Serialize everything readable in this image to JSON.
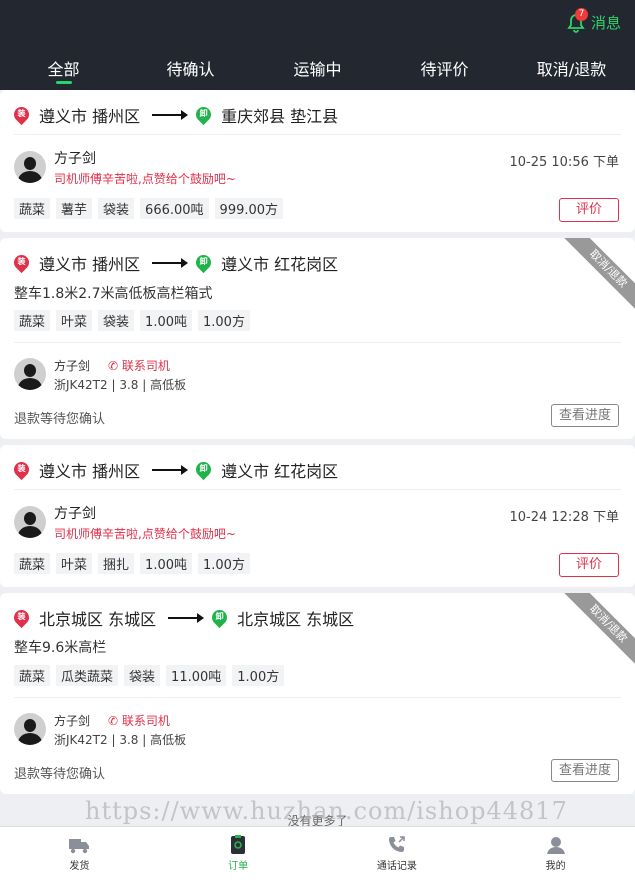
{
  "header": {
    "message_label": "消息",
    "message_count": "7",
    "tabs": [
      "全部",
      "待确认",
      "运输中",
      "待评价",
      "取消/退款"
    ],
    "active_tab": 0
  },
  "pins": {
    "load": "装",
    "unload": "卸"
  },
  "orders": [
    {
      "from": "遵义市 播州区",
      "to": "重庆郊县 垫江县",
      "name": "方子剑",
      "praise": "司机师傅辛苦啦,点赞给个鼓励吧~",
      "time": "10-25 10:56 下单",
      "tags": [
        "蔬菜",
        "薯芋",
        "袋装",
        "666.00吨",
        "999.00方"
      ],
      "action": "评价"
    },
    {
      "from": "遵义市 播州区",
      "to": "遵义市 红花岗区",
      "truck": "整车1.8米2.7米高低板高栏箱式",
      "tags": [
        "蔬菜",
        "叶菜",
        "袋装",
        "1.00吨",
        "1.00方"
      ],
      "driver": "方子剑",
      "call": "联系司机",
      "plate": "浙JK42T2 | 3.8 | 高低板",
      "status": "退款等待您确认",
      "action": "查看进度",
      "ribbon": "取消/退款"
    },
    {
      "from": "遵义市 播州区",
      "to": "遵义市 红花岗区",
      "name": "方子剑",
      "praise": "司机师傅辛苦啦,点赞给个鼓励吧~",
      "time": "10-24 12:28 下单",
      "tags": [
        "蔬菜",
        "叶菜",
        "捆扎",
        "1.00吨",
        "1.00方"
      ],
      "action": "评价"
    },
    {
      "from": "北京城区 东城区",
      "to": "北京城区 东城区",
      "truck": "整车9.6米高栏",
      "tags": [
        "蔬菜",
        "瓜类蔬菜",
        "袋装",
        "11.00吨",
        "1.00方"
      ],
      "driver": "方子剑",
      "call": "联系司机",
      "plate": "浙JK42T2 | 3.8 | 高低板",
      "status": "退款等待您确认",
      "action": "查看进度",
      "ribbon": "取消/退款"
    }
  ],
  "footer_text": "没有更多了",
  "watermark": "https://www.huzhan.com/ishop44817",
  "nav": [
    {
      "label": "发货",
      "icon": "truck-icon"
    },
    {
      "label": "订单",
      "icon": "order-icon"
    },
    {
      "label": "通话记录",
      "icon": "phone-icon"
    },
    {
      "label": "我的",
      "icon": "user-icon"
    }
  ],
  "colors": {
    "accent": "#2bd36a",
    "red": "#e0304a",
    "header_bg": "#232830"
  }
}
